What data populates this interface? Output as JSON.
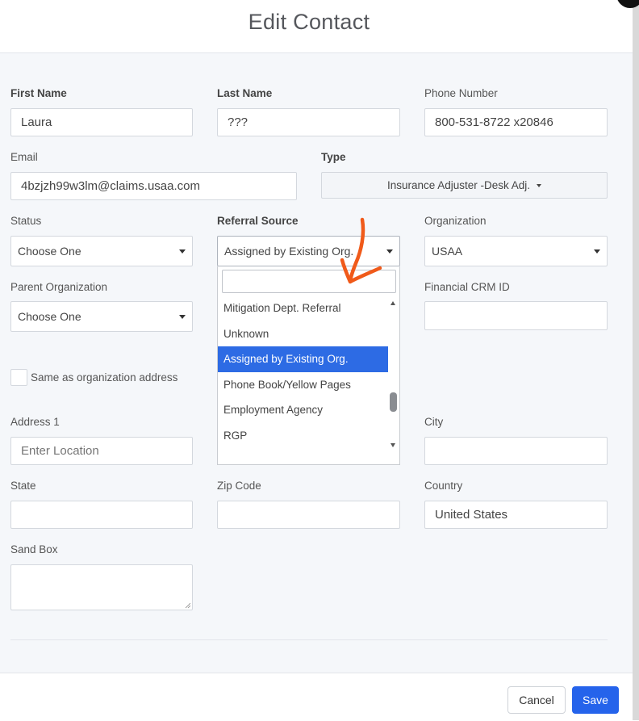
{
  "modal": {
    "title": "Edit Contact",
    "close_glyph": "×"
  },
  "fields": {
    "first_name": {
      "label": "First Name",
      "value": "Laura"
    },
    "last_name": {
      "label": "Last Name",
      "value": "???"
    },
    "phone": {
      "label": "Phone Number",
      "value": "800-531-8722 x20846"
    },
    "email": {
      "label": "Email",
      "value": "4bzjzh99w3lm@claims.usaa.com"
    },
    "type": {
      "label": "Type",
      "value": "Insurance Adjuster -Desk Adj."
    },
    "status": {
      "label": "Status",
      "value": "Choose One"
    },
    "referral_source": {
      "label": "Referral Source",
      "value": "Assigned by Existing Org."
    },
    "organization": {
      "label": "Organization",
      "value": "USAA"
    },
    "parent_org": {
      "label": "Parent Organization",
      "value": "Choose One"
    },
    "financial_crm": {
      "label": "Financial CRM ID",
      "value": ""
    },
    "same_address": {
      "label": "Same as organization address",
      "checked": false
    },
    "address1": {
      "label": "Address 1",
      "placeholder": "Enter Location"
    },
    "city": {
      "label": "City",
      "value": ""
    },
    "state": {
      "label": "State",
      "value": ""
    },
    "zip": {
      "label": "Zip Code",
      "value": ""
    },
    "country": {
      "label": "Country",
      "value": "United States"
    },
    "sandbox": {
      "label": "Sand Box",
      "value": ""
    }
  },
  "dropdown": {
    "search_value": "",
    "options": [
      "Mitigation Dept. Referral",
      "Unknown",
      "Assigned by Existing Org.",
      "Phone Book/Yellow Pages",
      "Employment Agency",
      "RGP"
    ],
    "selected": "Assigned by Existing Org."
  },
  "footer": {
    "cancel_label": "Cancel",
    "save_label": "Save"
  },
  "colors": {
    "primary": "#2563eb",
    "selected_option": "#2d6be4",
    "annotation": "#f05a1a"
  }
}
